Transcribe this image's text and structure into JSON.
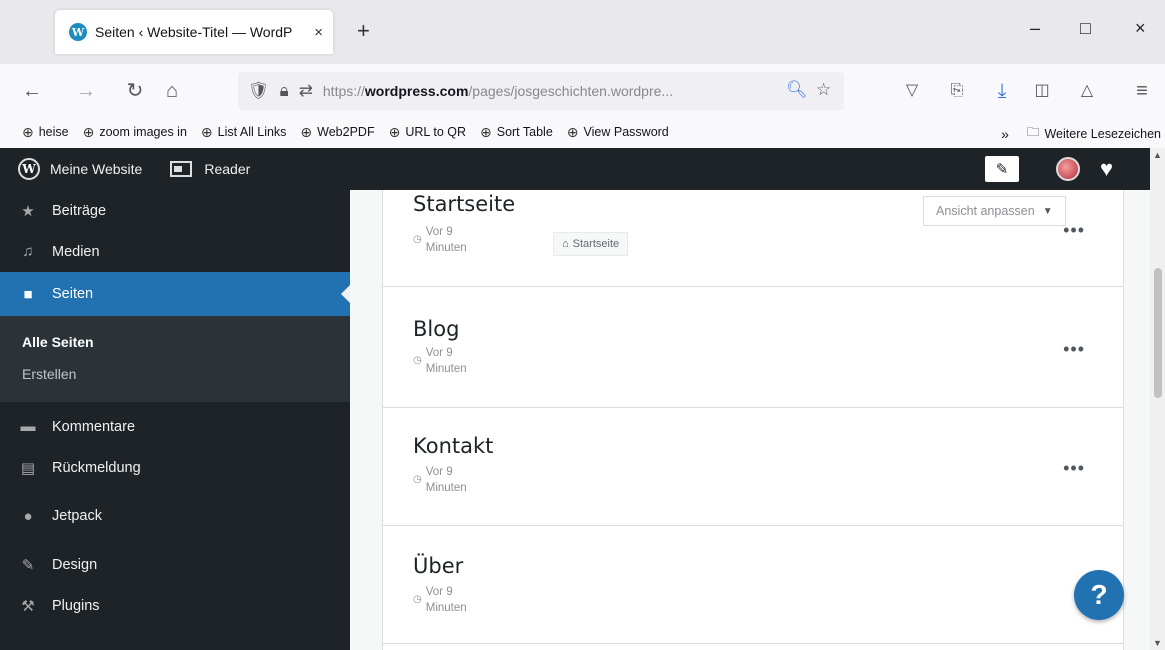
{
  "browser": {
    "tab": {
      "favicon": "W",
      "title": "Seiten ‹ Website-Titel — WordP",
      "close": "×"
    },
    "new_tab": "+",
    "window": {
      "minimize": "–",
      "maximize": "□",
      "close": "×"
    },
    "nav": {
      "back": "←",
      "forward": "→",
      "reload": "↻",
      "home": "⌂"
    },
    "url": {
      "prefix": "https://",
      "domain": "wordpress.com",
      "path": "/pages/josgeschichten.wordpre..."
    },
    "toolbar_icons": [
      "shield-icon",
      "lock-icon",
      "permissions-icon",
      "zoom-icon",
      "star-icon",
      "pocket-icon",
      "extension-icon",
      "download-icon",
      "sidebar-icon",
      "account-icon",
      "menu-icon"
    ],
    "bookmarks": [
      "heise",
      "zoom images in",
      "List All Links",
      "Web2PDF",
      "URL to QR",
      "Sort Table",
      "View Password"
    ],
    "bookmarks_more": "»",
    "bookmarks_folder": "Weitere Lesezeichen"
  },
  "adminbar": {
    "site": "Meine Website",
    "reader": "Reader"
  },
  "sidebar": {
    "items_top": [
      {
        "label": "Beiträge",
        "icon": "pin-icon"
      },
      {
        "label": "Medien",
        "icon": "media-icon"
      }
    ],
    "active": {
      "label": "Seiten",
      "icon": "pages-icon"
    },
    "submenu": [
      "Alle Seiten",
      "Erstellen"
    ],
    "items_bottom": [
      {
        "label": "Kommentare",
        "icon": "comment-icon"
      },
      {
        "label": "Rückmeldung",
        "icon": "feedback-icon"
      },
      {
        "label": "Jetpack",
        "icon": "jetpack-icon"
      },
      {
        "label": "Design",
        "icon": "brush-icon"
      },
      {
        "label": "Plugins",
        "icon": "plugin-icon"
      }
    ]
  },
  "main": {
    "view_button": "Ansicht anpassen",
    "pages": [
      {
        "title": "Startseite",
        "when_1": "Vor 9",
        "when_2": "Minuten",
        "badge": "Startseite"
      },
      {
        "title": "Blog",
        "when_1": "Vor 9",
        "when_2": "Minuten"
      },
      {
        "title": "Kontakt",
        "when_1": "Vor 9",
        "when_2": "Minuten"
      },
      {
        "title": "Über",
        "when_1": "Vor 9",
        "when_2": "Minuten"
      }
    ],
    "more": "•••"
  },
  "help": "?"
}
